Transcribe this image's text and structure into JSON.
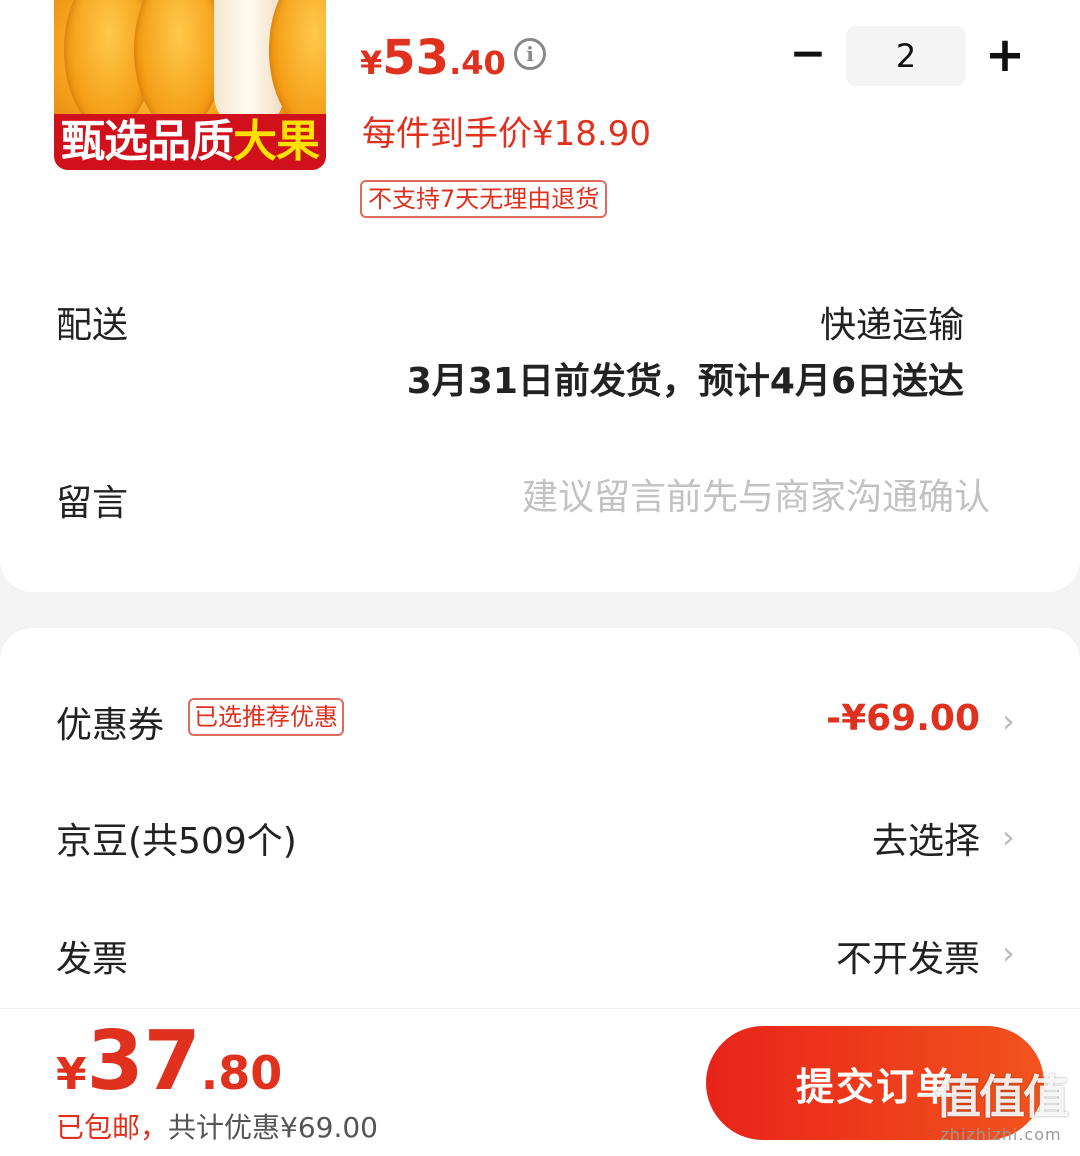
{
  "product": {
    "image_banner_main": "甄选品质",
    "image_banner_highlight": "大果",
    "price_currency": "¥",
    "price_int": "53",
    "price_dec": ".40",
    "unit_price": "每件到手价¥18.90",
    "return_policy_tag": "不支持7天无理由退货",
    "info_icon": "info-icon"
  },
  "quantity": {
    "minus_label": "−",
    "value": "2",
    "plus_label": "+"
  },
  "delivery": {
    "label": "配送",
    "method": "快递运输",
    "estimate": "3月31日前发货，预计4月6日送达"
  },
  "message": {
    "label": "留言",
    "placeholder": "建议留言前先与商家沟通确认"
  },
  "coupon": {
    "label": "优惠券",
    "tag": "已选推荐优惠",
    "value": "-¥69.00"
  },
  "jingdou": {
    "label": "京豆(共509个)",
    "value": "去选择"
  },
  "invoice": {
    "label": "发票",
    "value": "不开发票"
  },
  "chevron_glyph": "›",
  "total": {
    "currency": "¥",
    "int": "37",
    "dec": ".80",
    "free_shipping": "已包邮，",
    "discount_summary": "共计优惠¥69.00"
  },
  "submit": {
    "label": "提交订单"
  },
  "watermark": {
    "logo": "值值值",
    "text": "zhizhizhi.com"
  },
  "colors": {
    "accent": "#e0301e",
    "button_start": "#e8231a",
    "button_end": "#f2541d"
  }
}
